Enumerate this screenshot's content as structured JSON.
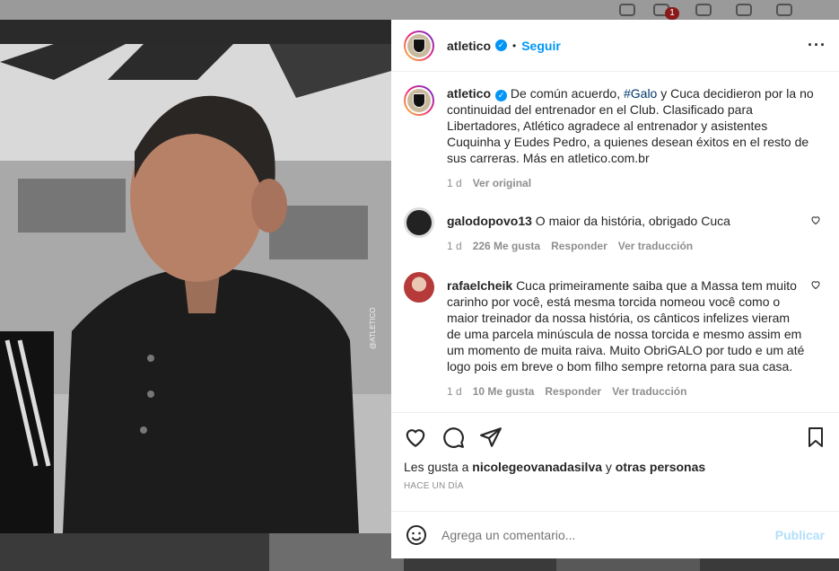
{
  "background": {
    "notification_badge": "1"
  },
  "post": {
    "username": "atletico",
    "follow_label": "Seguir",
    "more_icon": "ellipsis-icon",
    "watermark": "@ATLETICO",
    "caption": {
      "username": "atletico",
      "hashtag": "#Galo",
      "text_before_tag": "De común acuerdo,",
      "text_after_tag": "y Cuca decidieron por la no continuidad del entrenador en el Club. Clasificado para Libertadores, Atlético agradece al entrenador y asistentes Cuquinha y Eudes Pedro, a quienes desean éxitos en el resto de sus carreras. Más en atletico.com.br",
      "time": "1 d",
      "see_original": "Ver original"
    },
    "comments": [
      {
        "username": "galodopovo13",
        "text": "O maior da história, obrigado Cuca",
        "time": "1 d",
        "likes": "226 Me gusta",
        "reply": "Responder",
        "translate": "Ver traducción"
      },
      {
        "username": "rafaelcheik",
        "text": "Cuca primeiramente saiba que a Massa tem muito carinho por você, está mesma torcida nomeou você como o maior treinador da nossa história, os cânticos infelizes vieram de uma parcela minúscula de nossa torcida e mesmo assim em um momento de muita raiva. Muito ObriGALO por tudo e um até logo pois em breve o bom filho sempre retorna para sua casa.",
        "time": "1 d",
        "likes": "10 Me gusta",
        "reply": "Responder",
        "translate": "Ver traducción"
      }
    ],
    "likes": {
      "prefix": "Les gusta a",
      "user": "nicolegeovanadasilva",
      "middle": "y",
      "others": "otras personas"
    },
    "posted_ago": "HACE UN DÍA",
    "comment_placeholder": "Agrega un comentario...",
    "publish_label": "Publicar"
  },
  "colors": {
    "accent": "#0095f6",
    "publish_disabled": "#b2dffc",
    "muted": "#8e8e8e"
  }
}
